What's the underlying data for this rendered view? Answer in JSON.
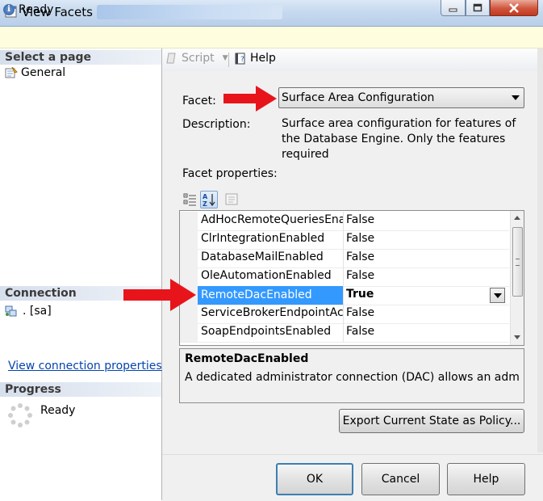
{
  "window": {
    "title": "View Facets -"
  },
  "status": {
    "text": "Ready"
  },
  "left_pane": {
    "select_page_header": "Select a page",
    "pages": [
      {
        "label": "General"
      }
    ],
    "connection_header": "Connection",
    "connection_value": ". [sa]",
    "view_connection_link": "View connection properties",
    "progress_header": "Progress",
    "progress_status": "Ready"
  },
  "toolbar": {
    "script_label": "Script",
    "help_label": "Help"
  },
  "facet": {
    "label": "Facet:",
    "selected": "Surface Area Configuration",
    "description_label": "Description:",
    "description": "Surface area configuration for features of the Database Engine. Only the features required",
    "properties_label": "Facet properties:"
  },
  "properties": [
    {
      "name": "AdHocRemoteQueriesEnal",
      "value": "False"
    },
    {
      "name": "ClrIntegrationEnabled",
      "value": "False"
    },
    {
      "name": "DatabaseMailEnabled",
      "value": "False"
    },
    {
      "name": "OleAutomationEnabled",
      "value": "False"
    },
    {
      "name": "RemoteDacEnabled",
      "value": "True",
      "selected": true
    },
    {
      "name": "ServiceBrokerEndpointActi",
      "value": "False"
    },
    {
      "name": "SoapEndpointsEnabled",
      "value": "False"
    }
  ],
  "help_panel": {
    "title": "RemoteDacEnabled",
    "description": "A dedicated administrator connection (DAC) allows an admi..."
  },
  "buttons": {
    "export": "Export Current State as Policy...",
    "ok": "OK",
    "cancel": "Cancel",
    "help": "Help"
  },
  "colors": {
    "selection": "#3399ff",
    "arrow": "#e8141c",
    "link": "#0645ad"
  }
}
